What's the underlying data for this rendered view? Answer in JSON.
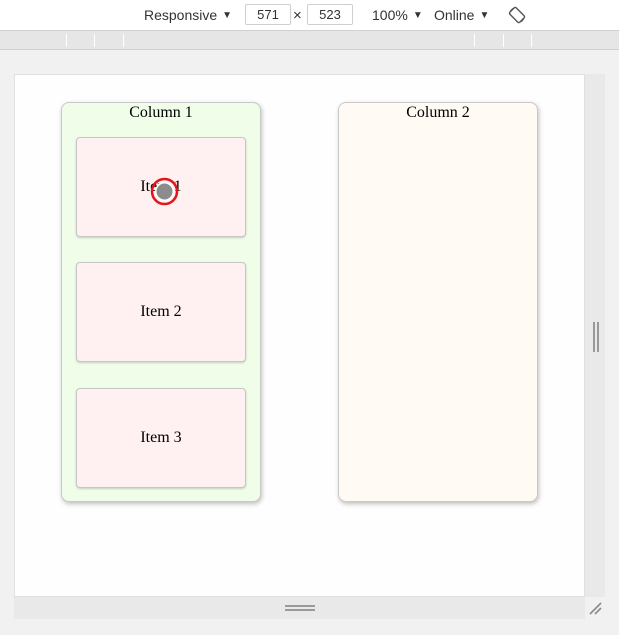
{
  "toolbar": {
    "device": "Responsive",
    "width": "571",
    "height": "523",
    "times": "×",
    "zoom": "100%",
    "throttle": "Online",
    "caret": "▼"
  },
  "board": {
    "columns": [
      {
        "title": "Column 1",
        "items": [
          "Item 1",
          "Item 2",
          "Item 3"
        ]
      },
      {
        "title": "Column 2",
        "items": []
      }
    ]
  },
  "colors": {
    "column1_bg": "#f0fde9",
    "column2_bg": "#fffaf4",
    "card_bg": "#fff0f1",
    "cursor_ring": "#e0161c"
  },
  "icons": {
    "rotate": "rotate-icon",
    "cursor": "touch-cursor-icon",
    "resize": "resize-corner-icon"
  }
}
